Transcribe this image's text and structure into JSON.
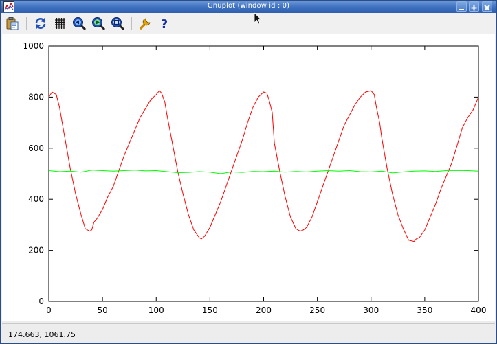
{
  "window": {
    "title": "Gnuplot (window id : 0)"
  },
  "toolbar": {
    "buttons": [
      {
        "name": "copy-to-clipboard",
        "icon": "clipboard-icon"
      },
      {
        "name": "replot",
        "icon": "refresh-icon"
      },
      {
        "name": "toggle-grid",
        "icon": "grid-icon"
      },
      {
        "name": "previous-zoom",
        "icon": "zoom-back-icon"
      },
      {
        "name": "next-zoom",
        "icon": "zoom-forward-icon"
      },
      {
        "name": "autoscale",
        "icon": "zoom-fit-icon"
      },
      {
        "name": "preferences",
        "icon": "wrench-icon"
      },
      {
        "name": "help",
        "icon": "help-icon"
      }
    ]
  },
  "status": {
    "coordinates": "174.663,  1061.75"
  },
  "chart_data": {
    "type": "line",
    "xlim": [
      0,
      400
    ],
    "ylim": [
      0,
      1000
    ],
    "xticks": [
      0,
      50,
      100,
      150,
      200,
      250,
      300,
      350,
      400
    ],
    "yticks": [
      0,
      200,
      400,
      600,
      800,
      1000
    ],
    "grid": false,
    "series": [
      {
        "color": "#ff0000",
        "x": [
          0,
          3,
          7,
          10,
          15,
          20,
          25,
          30,
          34,
          38,
          40,
          42,
          45,
          50,
          55,
          60,
          65,
          70,
          75,
          80,
          85,
          90,
          95,
          100,
          103,
          105,
          108,
          110,
          115,
          120,
          125,
          130,
          135,
          140,
          142,
          145,
          150,
          155,
          160,
          165,
          170,
          175,
          180,
          185,
          190,
          195,
          200,
          203,
          205,
          208,
          210,
          215,
          220,
          225,
          230,
          234,
          237,
          240,
          245,
          250,
          255,
          260,
          265,
          270,
          275,
          280,
          285,
          290,
          295,
          300,
          303,
          305,
          308,
          310,
          315,
          320,
          325,
          330,
          335,
          340,
          342,
          345,
          350,
          355,
          360,
          365,
          370,
          375,
          380,
          385,
          390,
          395,
          400
        ],
        "y": [
          800,
          820,
          810,
          760,
          640,
          520,
          420,
          340,
          285,
          275,
          280,
          310,
          325,
          360,
          410,
          450,
          510,
          570,
          620,
          670,
          720,
          755,
          790,
          810,
          825,
          815,
          780,
          730,
          620,
          510,
          420,
          340,
          280,
          250,
          245,
          255,
          290,
          340,
          390,
          450,
          510,
          570,
          630,
          700,
          760,
          800,
          820,
          815,
          790,
          740,
          620,
          510,
          410,
          330,
          285,
          275,
          280,
          290,
          330,
          390,
          450,
          510,
          570,
          630,
          690,
          730,
          770,
          800,
          820,
          825,
          810,
          760,
          700,
          640,
          520,
          420,
          340,
          285,
          240,
          235,
          245,
          250,
          280,
          330,
          380,
          440,
          490,
          540,
          610,
          680,
          720,
          750,
          800
        ]
      },
      {
        "color": "#00ff00",
        "x": [
          0,
          10,
          20,
          30,
          40,
          50,
          60,
          70,
          80,
          90,
          100,
          110,
          120,
          130,
          140,
          150,
          160,
          170,
          180,
          190,
          200,
          210,
          220,
          230,
          240,
          250,
          260,
          270,
          280,
          290,
          300,
          310,
          320,
          330,
          340,
          350,
          360,
          370,
          380,
          390,
          400
        ],
        "y": [
          512,
          508,
          510,
          506,
          514,
          512,
          510,
          512,
          514,
          511,
          512,
          508,
          504,
          505,
          508,
          506,
          500,
          507,
          505,
          509,
          508,
          510,
          506,
          509,
          507,
          510,
          512,
          510,
          512,
          508,
          507,
          510,
          503,
          507,
          510,
          511,
          509,
          512,
          513,
          512,
          510
        ]
      }
    ]
  }
}
